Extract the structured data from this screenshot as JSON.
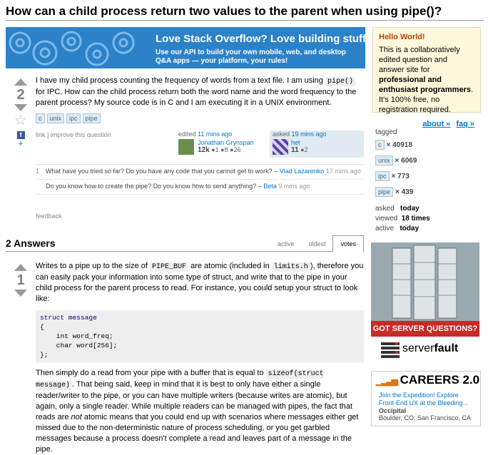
{
  "question": {
    "title": "How can a child process return two values to the parent when using pipe()?",
    "votes": "2",
    "body_before_code": "I have my child process counting the frequency of words from a text file. I am using ",
    "body_code": "pipe()",
    "body_after_code": " for IPC. How can the child process return both the word name and the word frequency to the parent process? My source code is in C and I am executing it in a UNIX environment.",
    "tags": [
      "c",
      "unix",
      "ipc",
      "pipe"
    ],
    "menu": "link | improve this question",
    "edited": {
      "action": "edited",
      "time": "11 mins ago",
      "user": "Jonathan Grynspan",
      "rep": "12k",
      "badges": "●1 ●8 ●26"
    },
    "asked": {
      "action": "asked",
      "time": "19 mins ago",
      "user": "het",
      "rep": "11",
      "badges": "●2"
    },
    "comments": [
      {
        "vote": "1",
        "text": "What have you tried so far? Do you have any code that you cannot get to work? – ",
        "user": "Vlad Lazarenko",
        "date": "17 mins ago"
      },
      {
        "vote": "",
        "text": "Do you know how to create the pipe? Do you know how to send anything? – ",
        "user": "Beta",
        "date": "9 mins ago"
      }
    ],
    "feedback": "feedback"
  },
  "banner": {
    "title": "Love Stack Overflow? Love building stuff?",
    "subtitle": "Use our API to build your own mobile, web, and desktop Q&A apps — your platform, your rules!"
  },
  "answers": {
    "header": "2 Answers",
    "tabs": [
      "active",
      "oldest",
      "votes"
    ],
    "active_tab": "votes",
    "first": {
      "votes": "1",
      "p1_a": "Writes to a pipe up to the size of ",
      "p1_code1": "PIPE_BUF",
      "p1_b": " are atomic (included in ",
      "p1_code2": "limits.h",
      "p1_c": "), therefore you can easily pack your information into some type of struct, and write that to the pipe in your child process for the parent process to read. For instance, you could setup your struct to look like:",
      "code_lines": [
        "struct message",
        "{",
        "    int word_freq;",
        "    char word[256];",
        "};"
      ],
      "p2_a": "Then simply do a read from your pipe with a buffer that is equal to ",
      "p2_code": "sizeof(struct message)",
      "p2_b": ". That being said, keep in mind that it is best to only have either a single reader/writer to the pipe, or you can have multiple writers (because writes are atomic), but again, only a single reader. While multiple readers can be managed with pipes, the fact that reads are ",
      "p2_em": "not",
      "p2_c": " atomic means that you could end up with scenarios where messages either get missed due to the non-deterministic nature of process scheduling, or you get garbled messages because a process doesn't complete a read and leaves part of a message in the pipe."
    }
  },
  "sidebar": {
    "hello_title": "Hello World!",
    "hello_text_a": "This is a collaboratively edited question and answer site for ",
    "hello_text_bold": "professional and enthusiast programmers",
    "hello_text_b": ". It's 100% free, no registration required.",
    "about": "about »",
    "faq": "faq »",
    "tagged_label": "tagged",
    "tagged": [
      {
        "tag": "c",
        "count": "× 40918"
      },
      {
        "tag": "unix",
        "count": "× 6069"
      },
      {
        "tag": "ipc",
        "count": "× 773"
      },
      {
        "tag": "pipe",
        "count": "× 439"
      }
    ],
    "stats": [
      {
        "label": "asked",
        "value": "today"
      },
      {
        "label": "viewed",
        "value": "18 times"
      },
      {
        "label": "active",
        "value": "today"
      }
    ],
    "sf_ad_tagline": "GOT SERVER QUESTIONS? TRY:",
    "sf_ad_logo_a": "server",
    "sf_ad_logo_b": "fault",
    "careers_title": "CAREERS 2.0",
    "careers_link": "Join the Expedition! Explore Front-End UX at the Bleeding...",
    "careers_company": "Occipital",
    "careers_location": "Boulder, CO; San Francisco, CA"
  },
  "colors": {
    "link": "#0077cc",
    "tag_bg": "#e0eaf1",
    "banner": "#2b82c9",
    "ad_red": "#c72b26"
  }
}
